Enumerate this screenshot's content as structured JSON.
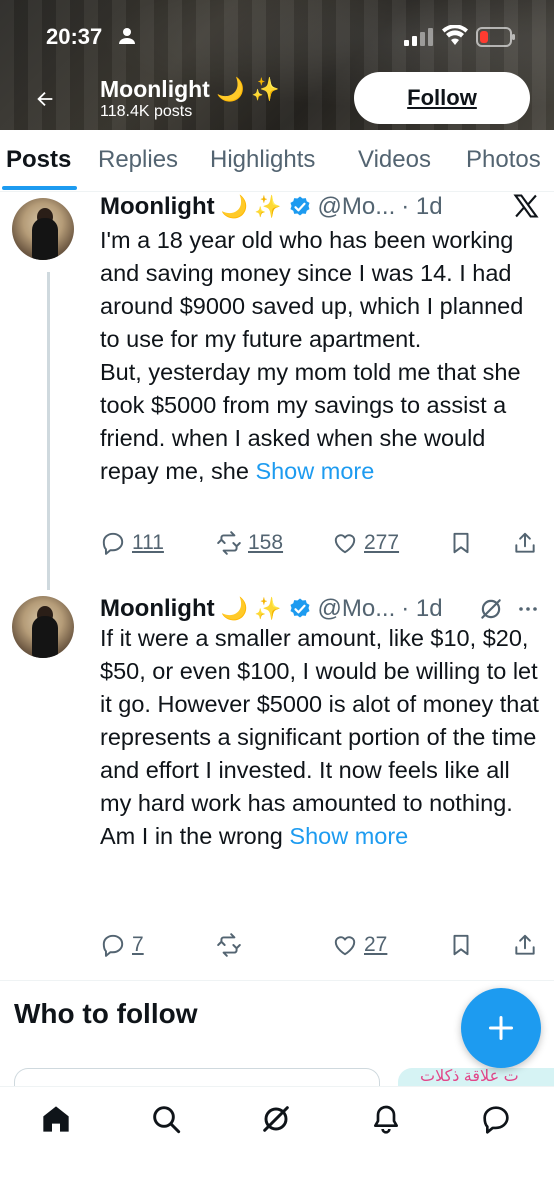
{
  "status_bar": {
    "time": "20:37"
  },
  "header": {
    "name": "Moonlight",
    "name_emoji": "🌙 ✨",
    "posts_count": "118.4K posts",
    "follow_label": "Follow"
  },
  "tabs": [
    {
      "label": "Posts",
      "active": true
    },
    {
      "label": "Replies"
    },
    {
      "label": "Highlights"
    },
    {
      "label": "Videos"
    },
    {
      "label": "Photos"
    }
  ],
  "posts": [
    {
      "name": "Moonlight",
      "emoji": "🌙 ✨",
      "handle": "@Mo...",
      "time": "· 1d",
      "text": "I'm a 18 year old who has been working and saving money since I was 14. I had around $9000 saved up, which I planned to use for my future apartment.\nBut, yesterday my mom told me that she took $5000 from my savings to assist a friend. when I asked when she would repay me, she",
      "show_more": "Show more",
      "replies": "111",
      "reposts": "158",
      "likes": "277"
    },
    {
      "name": "Moonlight",
      "emoji": "🌙 ✨",
      "handle": "@Mo...",
      "time": "· 1d",
      "text": "If it were a smaller amount, like $10, $20, $50, or even $100, I would be willing to let it go. However $5000 is alot of money that represents a significant portion of the time and effort I invested. It now feels like all my hard work has amounted to nothing. Am I in the wrong",
      "show_more": "Show more",
      "replies": "7",
      "reposts": "",
      "likes": "27"
    }
  ],
  "who_to_follow": {
    "title": "Who to follow",
    "peek_text": "ت علاقة ذكلات"
  },
  "icons": {
    "back": "arrow-left-icon",
    "verified": "verified-badge-icon",
    "x_logo": "x-logo-icon",
    "grok": "grok-icon",
    "more": "more-icon",
    "reply": "reply-icon",
    "repost": "repost-icon",
    "like": "heart-icon",
    "bookmark": "bookmark-icon",
    "share": "share-icon",
    "compose": "plus-icon",
    "nav": [
      "home-icon",
      "search-icon",
      "grok-icon",
      "notifications-icon",
      "messages-icon"
    ]
  },
  "colors": {
    "accent": "#1d9bf0",
    "text": "#0f1419",
    "muted": "#536471"
  }
}
